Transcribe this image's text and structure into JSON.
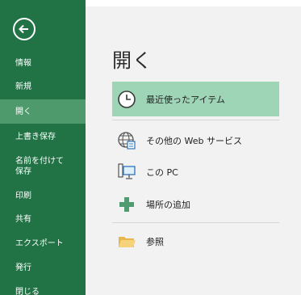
{
  "sidebar": {
    "back_label": "戻る",
    "items": [
      {
        "label": "情報"
      },
      {
        "label": "新規"
      },
      {
        "label": "開く"
      },
      {
        "label": "上書き保存"
      },
      {
        "label": "名前を付けて"
      },
      {
        "label": "保存"
      },
      {
        "label": "印刷"
      },
      {
        "label": "共有"
      },
      {
        "label": "エクスポート"
      },
      {
        "label": "発行"
      },
      {
        "label": "閉じる"
      }
    ],
    "active_item": "開く"
  },
  "main": {
    "title": "開く",
    "locations": [
      {
        "label": "最近使ったアイテム",
        "icon": "clock-icon",
        "selected": true
      },
      {
        "label": "その他の Web サービス",
        "icon": "globe-icon"
      },
      {
        "label": "この PC",
        "icon": "computer-icon"
      },
      {
        "label": "場所の追加",
        "icon": "plus-icon"
      },
      {
        "label": "参照",
        "icon": "folder-icon"
      }
    ]
  },
  "colors": {
    "sidebar_bg": "#217346",
    "sidebar_active": "#4e9a6d",
    "selected_row": "#9fd5b7"
  }
}
